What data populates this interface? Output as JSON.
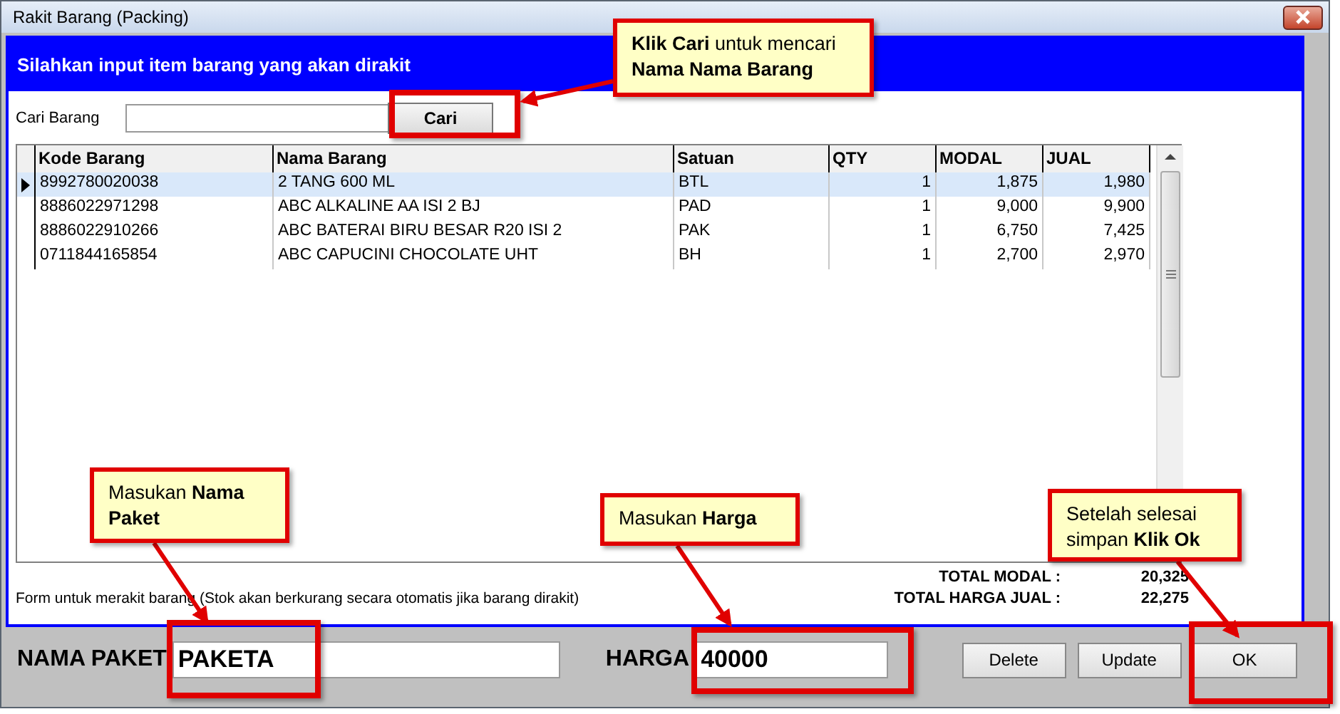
{
  "window": {
    "title": "Rakit Barang (Packing)"
  },
  "header": "Silahkan input item barang yang akan dirakit",
  "search": {
    "label": "Cari Barang",
    "button": "Cari"
  },
  "table": {
    "columns": [
      "Kode Barang",
      "Nama Barang",
      "Satuan",
      "QTY",
      "MODAL",
      "JUAL"
    ],
    "rows": [
      {
        "selected": true,
        "cells": [
          "8992780020038",
          "2 TANG 600 ML",
          "BTL",
          "1",
          "1,875",
          "1,980"
        ]
      },
      {
        "selected": false,
        "cells": [
          "8886022971298",
          "ABC ALKALINE AA ISI 2 BJ",
          "PAD",
          "1",
          "9,000",
          "9,900"
        ]
      },
      {
        "selected": false,
        "cells": [
          "8886022910266",
          "ABC BATERAI BIRU BESAR R20 ISI 2",
          "PAK",
          "1",
          "6,750",
          "7,425"
        ]
      },
      {
        "selected": false,
        "cells": [
          "0711844165854",
          "ABC CAPUCINI CHOCOLATE UHT",
          "BH",
          "1",
          "2,700",
          "2,970"
        ]
      }
    ]
  },
  "note": "Form untuk merakit barang (Stok akan berkurang secara otomatis jika barang dirakit)",
  "totals": [
    {
      "label": "TOTAL MODAL :",
      "value": "20,325"
    },
    {
      "label": "TOTAL HARGA JUAL :",
      "value": "22,275"
    }
  ],
  "package_name": {
    "label": "NAMA PAKET",
    "value": "PAKETA"
  },
  "price": {
    "label": "HARGA",
    "value": "40000"
  },
  "buttons": [
    "Delete",
    "Update",
    "OK"
  ],
  "annotations": [
    {
      "text": "**Klik Cari** untuk mencari **Nama Nama Barang**"
    },
    {
      "text": "Masukan **Nama Paket**"
    },
    {
      "text": "Masukan **Harga**"
    },
    {
      "text": "Setelah selesai simpan **Klik Ok**"
    }
  ]
}
